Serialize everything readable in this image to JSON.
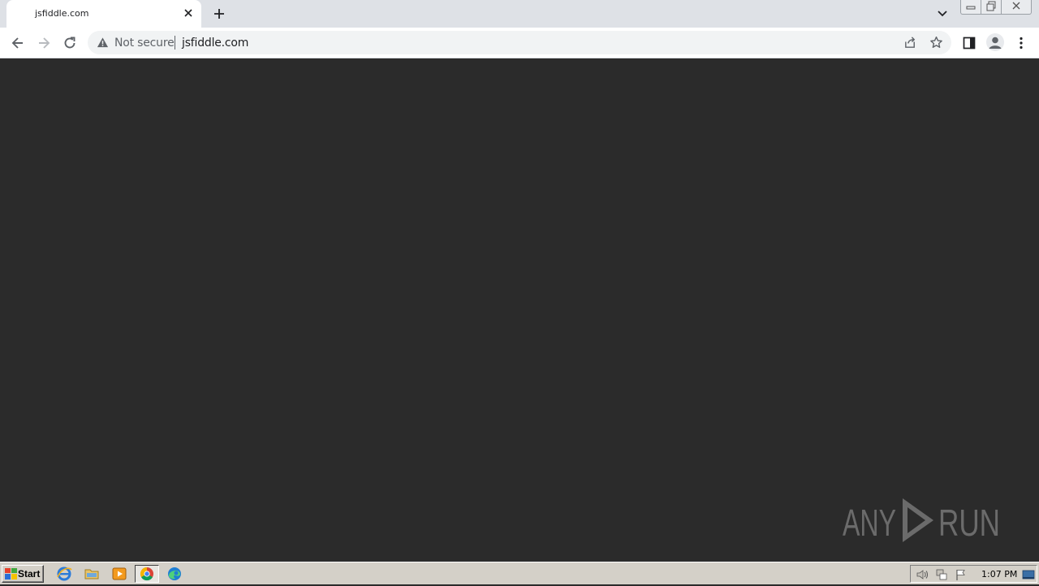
{
  "browser": {
    "tab": {
      "title": "jsfiddle.com"
    },
    "address_bar": {
      "security_label": "Not secure",
      "url": "jsfiddle.com"
    }
  },
  "watermark": {
    "left_text": "ANY",
    "right_text": "RUN"
  },
  "taskbar": {
    "start_label": "Start",
    "clock": "1:07 PM"
  },
  "colors": {
    "content_bg": "#2b2b2b",
    "tabstrip_bg": "#dee1e6",
    "omnibox_bg": "#f1f3f4",
    "taskbar_bg": "#d4d0c8"
  },
  "icons": [
    "close-icon",
    "plus-icon",
    "chevron-down-icon",
    "minimize-icon",
    "restore-icon",
    "back-arrow-icon",
    "forward-arrow-icon",
    "reload-icon",
    "warning-icon",
    "share-icon",
    "star-icon",
    "side-panel-icon",
    "profile-icon",
    "kebab-menu-icon",
    "windows-logo-icon",
    "internet-explorer-icon",
    "folder-icon",
    "media-player-icon",
    "chrome-icon",
    "edge-icon",
    "speaker-icon",
    "network-icon",
    "flag-icon",
    "show-desktop-icon"
  ]
}
